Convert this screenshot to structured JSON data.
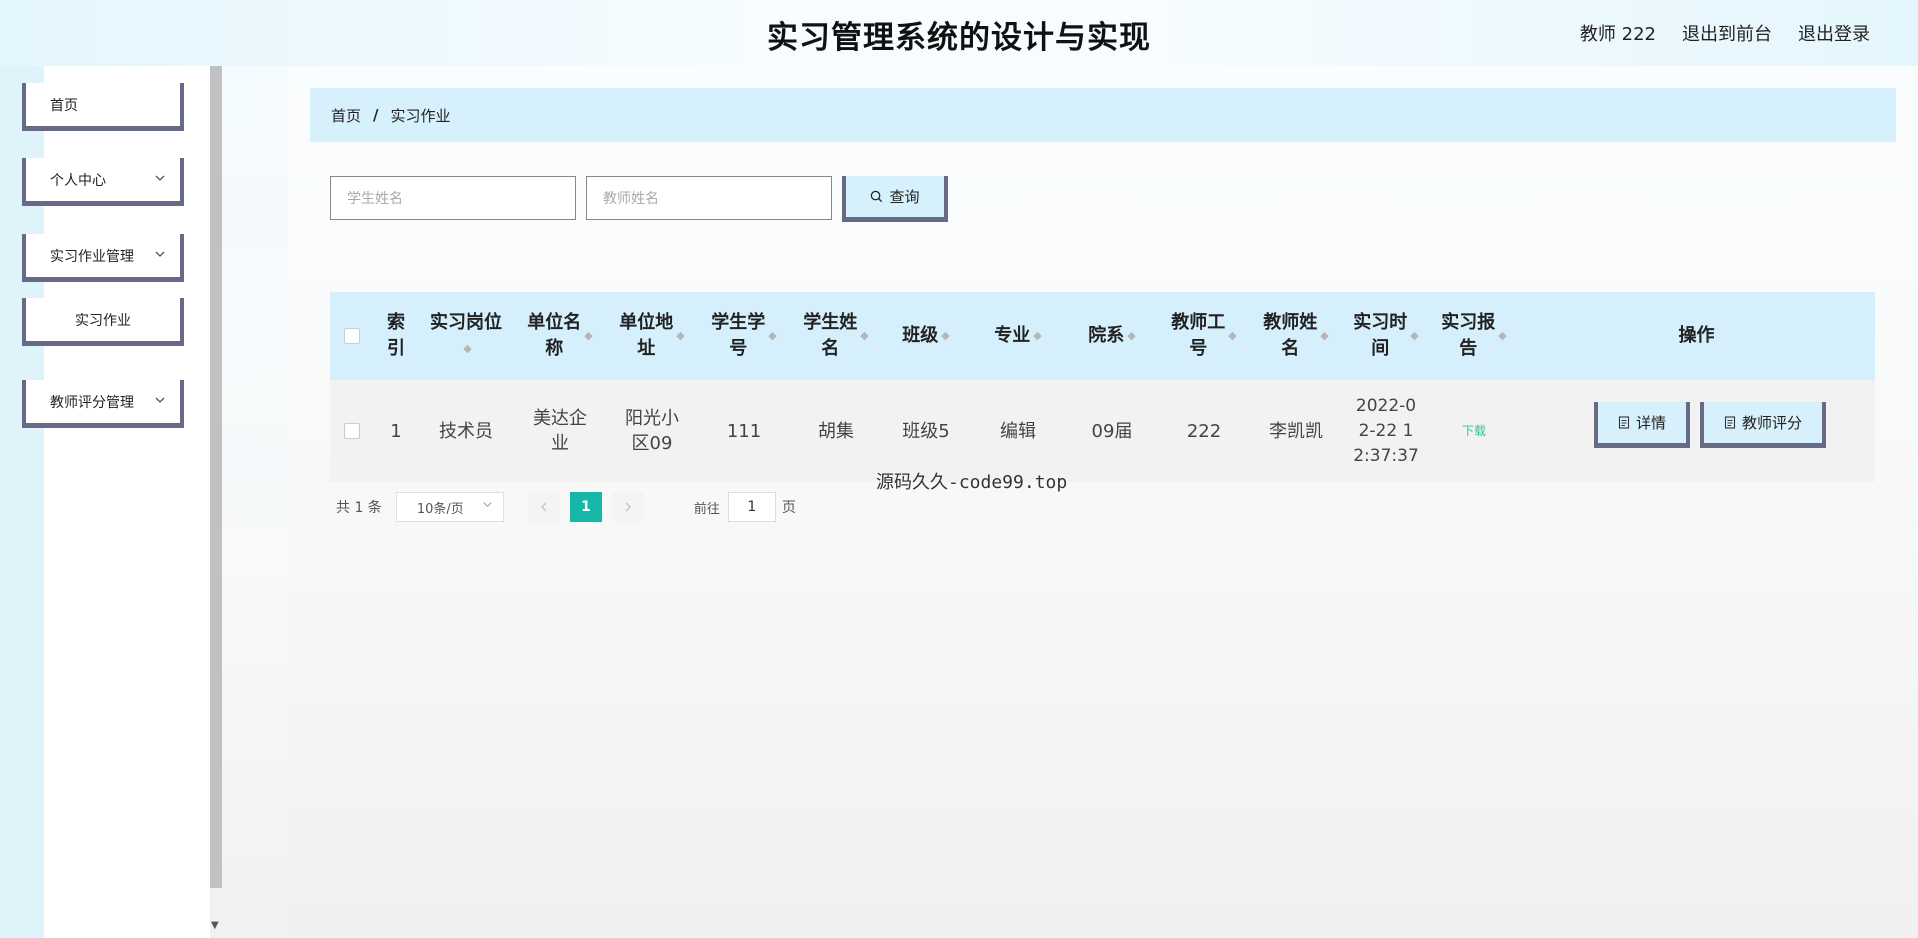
{
  "header": {
    "title": "实习管理系统的设计与实现",
    "user": "教师 222",
    "to_front": "退出到前台",
    "logout": "退出登录"
  },
  "sidebar": {
    "items": [
      {
        "label": "首页"
      },
      {
        "label": "个人中心",
        "icon": "chevron-down-icon"
      },
      {
        "label": "实习作业管理",
        "icon": "chevron-down-icon"
      },
      {
        "label": "实习作业"
      },
      {
        "label": "教师评分管理",
        "icon": "chevron-down-icon"
      }
    ]
  },
  "breadcrumb": {
    "home": "首页",
    "separator": "/",
    "current": "实习作业"
  },
  "search": {
    "student_name_placeholder": "学生姓名",
    "teacher_name_placeholder": "教师姓名",
    "button_label": "查询"
  },
  "table": {
    "headers": [
      "索\n引",
      "实习岗位",
      "单位名\n称",
      "单位地\n址",
      "学生学\n号",
      "学生姓\n名",
      "班级",
      "专业",
      "院系",
      "教师工\n号",
      "教师姓\n名",
      "实习时\n间",
      "实习报\n告",
      "操作"
    ],
    "rows": [
      {
        "index": "1",
        "position": "技术员",
        "company": "美达企\n业",
        "address": "阳光小\n区09",
        "student_id": "111",
        "student_name": "胡集",
        "class": "班级5",
        "major": "编辑",
        "department": "09届",
        "teacher_id": "222",
        "teacher_name": "李凯凯",
        "time": "2022-0\n2-22 1\n2:37:37",
        "report": "下载",
        "detail_label": "详情",
        "score_label": "教师评分"
      }
    ]
  },
  "watermark": "源码久久-code99.top",
  "pagination": {
    "total": "共 1 条",
    "page_size": "10条/页",
    "current_page": "1",
    "goto_label": "前往",
    "goto_value": "1",
    "page_unit": "页"
  },
  "colors": {
    "accent": "#d7f1fc",
    "border": "#666a86",
    "active_page": "#16b7a6",
    "download": "#34c38f"
  }
}
